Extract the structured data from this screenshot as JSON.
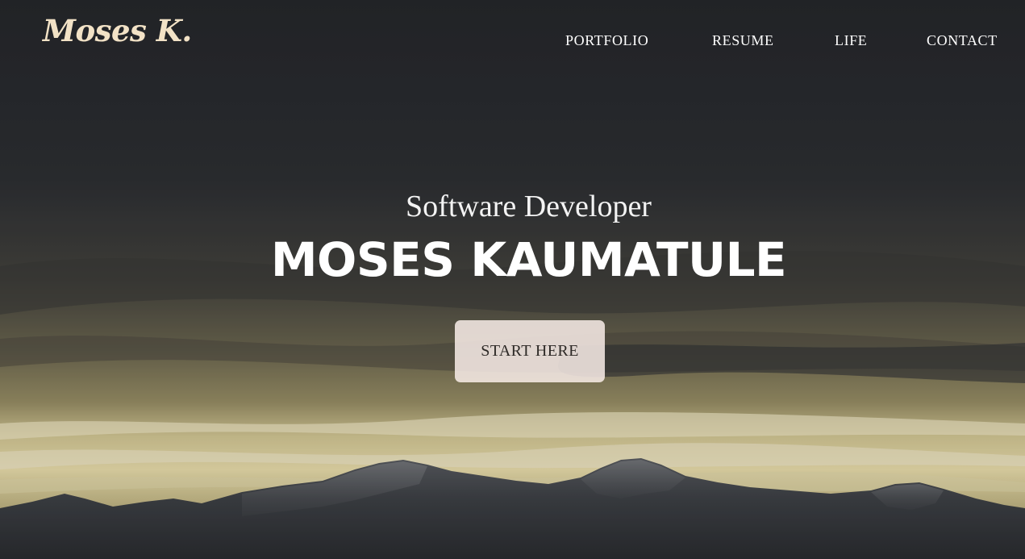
{
  "header": {
    "logo_text": "Moses K.",
    "nav": {
      "portfolio": "PORTFOLIO",
      "resume": "RESUME",
      "life": "LIFE",
      "contact": "CONTACT"
    }
  },
  "hero": {
    "subtitle": "Software Developer",
    "name": "MOSES KAUMATULE",
    "cta_label": "START HERE"
  },
  "colors": {
    "logo": "#f2e2c6",
    "text": "#ffffff",
    "button_bg": "#f8ece8",
    "button_text": "#2d2926",
    "sky_dark": "#2a2c30",
    "sky_glow": "#e9dca6",
    "mountains": "#3a3d42"
  }
}
